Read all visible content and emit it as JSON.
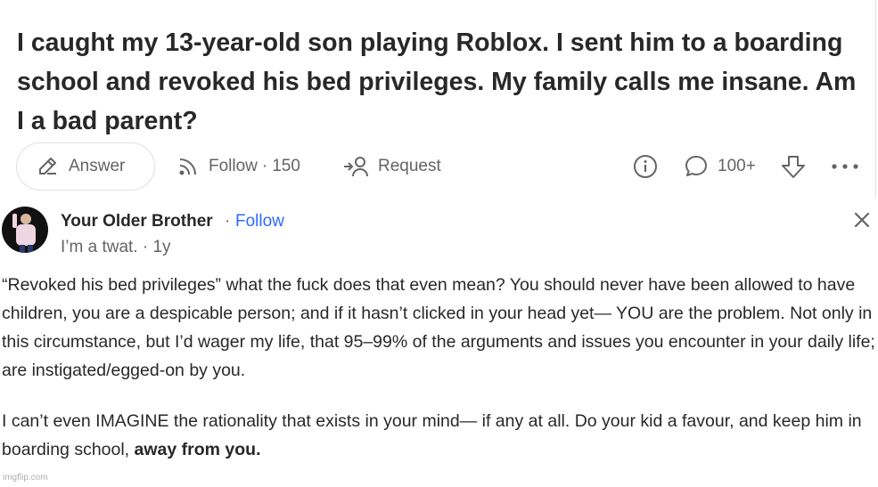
{
  "question": {
    "title": "I caught my 13-year-old son playing Roblox. I sent him to a boarding school and revoked his bed privileges. My family calls me insane. Am I a bad parent?",
    "actions": {
      "answer_label": "Answer",
      "follow_label": "Follow",
      "follow_count": "150",
      "request_label": "Request",
      "comments_count": "100+"
    }
  },
  "answer": {
    "author_name": "Your Older Brother",
    "separator": "·",
    "follow_label": "Follow",
    "credential": "I’m a twat. · 1y",
    "paragraph1": "“Revoked his bed privileges” what the fuck does that even mean? You should never have been allowed to have children, you are a despicable person; and if it hasn’t clicked in your head yet— YOU are the problem. Not only in this circumstance, but I’d wager my life, that 95–99% of the arguments and issues you encounter in your daily life; are instigated/egged-on by you.",
    "paragraph2_text": "I can’t even IMAGINE the rationality that exists in your mind— if any at all. Do your kid a favour, and keep him in boarding school, ",
    "paragraph2_bold": "away from you."
  },
  "watermark": "imgflip.com",
  "colors": {
    "text": "#282829",
    "secondary": "#636466",
    "link": "#2e69ff",
    "border": "#dee0e1"
  },
  "icons": [
    "pencil-icon",
    "follow-signal-icon",
    "request-icon",
    "info-icon",
    "comment-icon",
    "downvote-icon",
    "more-icon",
    "close-icon"
  ]
}
